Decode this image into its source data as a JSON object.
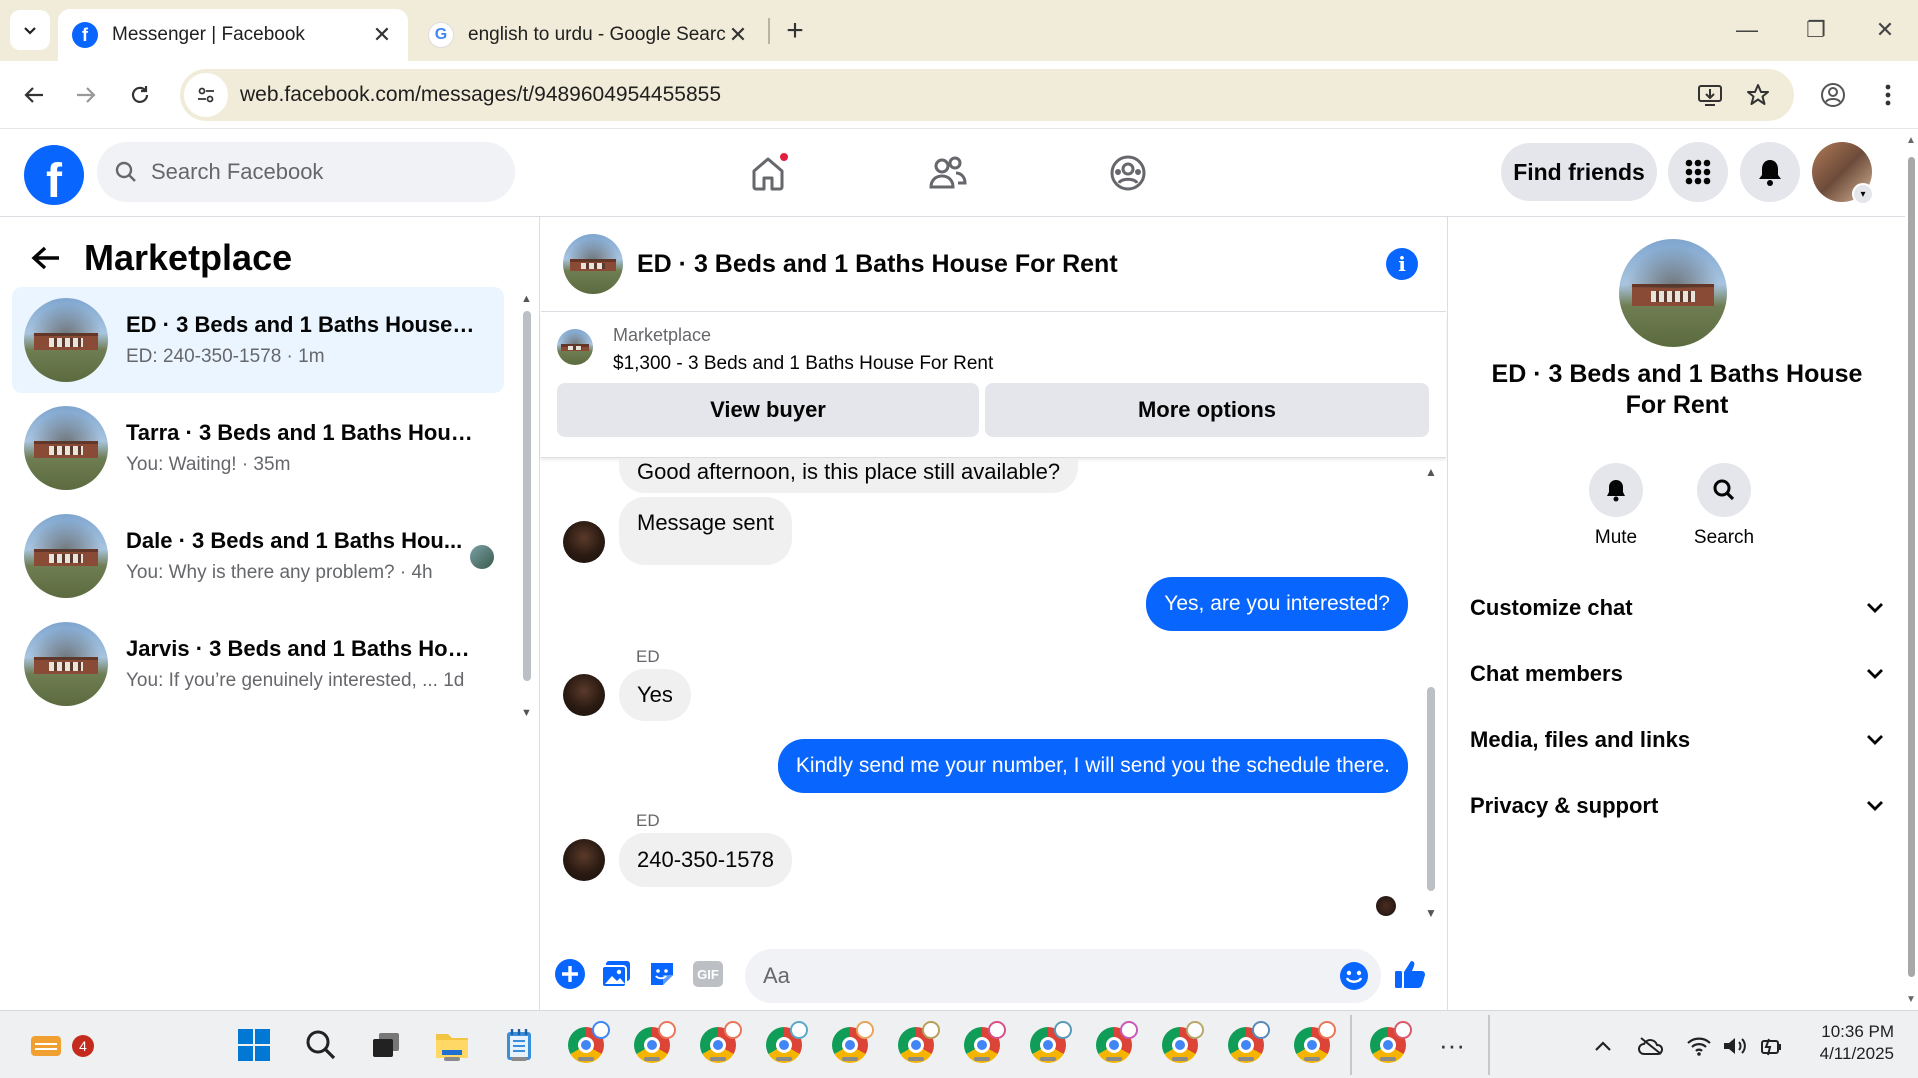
{
  "browser": {
    "tabs": [
      {
        "title": "Messenger | Facebook",
        "active": true,
        "icon": "facebook-icon"
      },
      {
        "title": "english to urdu - Google Search",
        "active": false,
        "icon": "google-icon"
      }
    ],
    "url": "web.facebook.com/messages/t/9489604954455855"
  },
  "fb": {
    "search_placeholder": "Search Facebook",
    "find_friends": "Find friends"
  },
  "left": {
    "title": "Marketplace",
    "conversations": [
      {
        "name": "ED · 3 Beds and 1 Baths House F...",
        "preview": "ED: 240-350-1578 · 1m",
        "selected": true
      },
      {
        "name": "Tarra · 3 Beds and 1 Baths House...",
        "preview": "You: Waiting! · 35m",
        "selected": false
      },
      {
        "name": "Dale · 3 Beds and 1 Baths Hou...",
        "preview": "You: Why is there any problem? · 4h",
        "selected": false
      },
      {
        "name": "Jarvis · 3 Beds and 1 Baths Hous...",
        "preview": "You: If you’re genuinely interested, ...  1d",
        "selected": false
      }
    ]
  },
  "chat": {
    "title": "ED · 3 Beds and 1 Baths House For Rent",
    "marketplace_label": "Marketplace",
    "listing": "$1,300 - 3 Beds and 1 Baths House For Rent",
    "view_buyer": "View buyer",
    "more_options": "More options",
    "messages": [
      {
        "from": "them",
        "text": "Good afternoon, is this place still available?"
      },
      {
        "from": "them",
        "text": "Message sent"
      },
      {
        "from": "me",
        "text": "Yes, are you interested?"
      },
      {
        "from": "them",
        "sender": "ED",
        "text": "Yes"
      },
      {
        "from": "me",
        "text": "Kindly send me your number, I will send you the schedule there."
      },
      {
        "from": "them",
        "sender": "ED",
        "text": "240-350-1578"
      }
    ],
    "composer_placeholder": "Aa"
  },
  "right": {
    "title": "ED · 3 Beds and 1 Baths House For Rent",
    "mute": "Mute",
    "search": "Search",
    "sections": [
      "Customize chat",
      "Chat members",
      "Media, files and links",
      "Privacy & support"
    ]
  },
  "taskbar": {
    "weather_badge": "4",
    "time": "10:36 PM",
    "date": "4/11/2025"
  },
  "colors": {
    "accent": "#0866ff",
    "selected_row": "#ebf5ff",
    "bubble_in": "#f0f0f0",
    "chrome_tabbar": "#f1ecd9"
  }
}
